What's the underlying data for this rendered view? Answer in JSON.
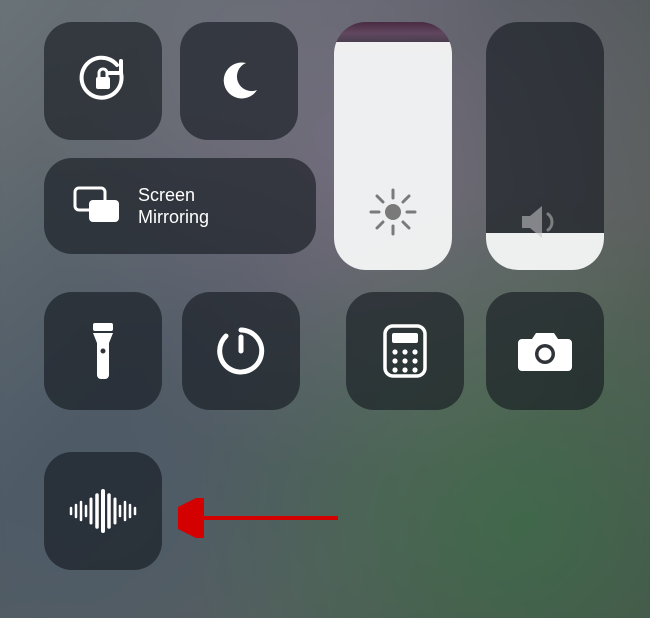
{
  "screen_mirroring_label": "Screen\nMirroring",
  "brightness_percent": 92,
  "volume_percent": 15,
  "icons": {
    "rotation_lock": "rotation-lock-icon",
    "dnd": "moon-icon",
    "screen_mirroring": "screen-mirroring-icon",
    "brightness": "sun-icon",
    "volume": "speaker-icon",
    "flashlight": "flashlight-icon",
    "timer": "timer-icon",
    "calculator": "calculator-icon",
    "camera": "camera-icon",
    "voice_memos": "waveform-icon"
  },
  "colors": {
    "tile_bg": "rgba(20,25,30,0.62)",
    "icon": "#ffffff",
    "arrow": "#d40000"
  },
  "annotation_arrow_target": "voice-memos-button"
}
